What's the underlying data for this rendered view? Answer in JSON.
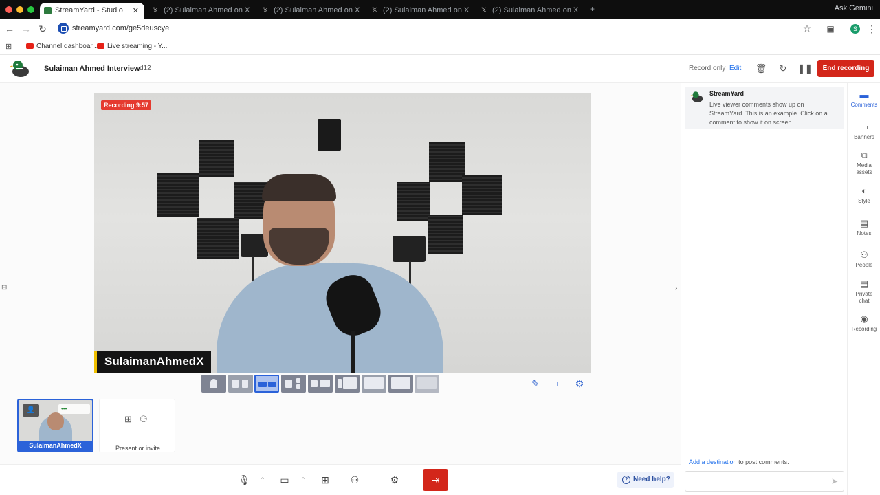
{
  "browser": {
    "tabs": [
      {
        "title": "StreamYard - Studio",
        "active": true
      },
      {
        "title": "(2) Sulaiman Ahmed on X",
        "active": false
      },
      {
        "title": "(2) Sulaiman Ahmed on X",
        "active": false
      },
      {
        "title": "(2) Sulaiman Ahmed on X",
        "active": false
      },
      {
        "title": "(2) Sulaiman Ahmed on X",
        "active": false
      }
    ],
    "gemini_label": "Ask Gemini",
    "url": "streamyard.com/ge5deuscye",
    "profile_initial": "S",
    "bookmarks": [
      {
        "label": "Channel dashboar..."
      },
      {
        "label": "Live streaming - Y..."
      }
    ]
  },
  "header": {
    "title": "Sulaiman Ahmed Interview",
    "breadcrumb_sep": "›",
    "sub": "d12",
    "record_mode": "Record only",
    "edit_label": "Edit",
    "end_recording_label": "End recording"
  },
  "stage": {
    "recording_badge": "Recording 9:57",
    "name_tag": "SulaimanAhmedX",
    "layouts_count": 9,
    "selected_layout": 3
  },
  "participants": [
    {
      "name": "SulaimanAhmedX"
    }
  ],
  "invite_label": "Present or invite",
  "controls": {
    "need_help_label": "Need help?"
  },
  "comments": {
    "author": "StreamYard",
    "text": "Live viewer comments show up on StreamYard. This is an example. Click on a comment to show it on screen.",
    "add_destination_link": "Add a destination",
    "add_destination_rest": " to post comments."
  },
  "rail": [
    {
      "label": "Comments",
      "icon": "comment-icon",
      "active": true
    },
    {
      "label": "Banners",
      "icon": "banner-icon",
      "active": false
    },
    {
      "label": "Media assets",
      "icon": "media-icon",
      "active": false
    },
    {
      "label": "Style",
      "icon": "palette-icon",
      "active": false
    },
    {
      "label": "Notes",
      "icon": "notes-icon",
      "active": false
    },
    {
      "label": "People",
      "icon": "people-icon",
      "active": false
    },
    {
      "label": "Private chat",
      "icon": "chat-icon",
      "active": false
    },
    {
      "label": "Recording",
      "icon": "record-icon",
      "active": false
    }
  ],
  "colors": {
    "accent": "#2b62d9",
    "danger": "#d3261a",
    "recording_badge": "#e53a2f",
    "name_tag_bar": "#f0c000"
  }
}
